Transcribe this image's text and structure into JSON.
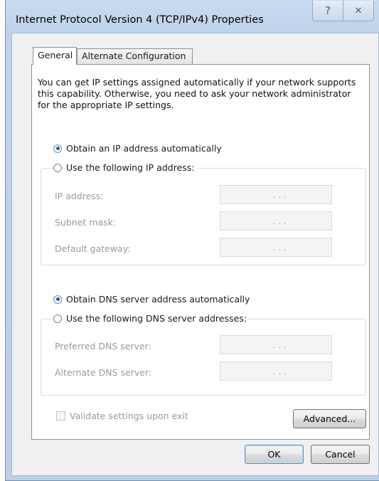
{
  "window": {
    "title": "Internet Protocol Version 4 (TCP/IPv4) Properties",
    "help_glyph": "?",
    "close_glyph": "✕"
  },
  "tabs": [
    {
      "label": "General",
      "selected": true
    },
    {
      "label": "Alternate Configuration",
      "selected": false
    }
  ],
  "general": {
    "intro": "You can get IP settings assigned automatically if your network supports this capability. Otherwise, you need to ask your network administrator for the appropriate IP settings.",
    "ip_auto_label": "Obtain an IP address automatically",
    "ip_manual_label": "Use the following IP address:",
    "ip_fields": [
      {
        "label": "IP address:",
        "value": ". . ."
      },
      {
        "label": "Subnet mask:",
        "value": ". . ."
      },
      {
        "label": "Default gateway:",
        "value": ". . ."
      }
    ],
    "dns_auto_label": "Obtain DNS server address automatically",
    "dns_manual_label": "Use the following DNS server addresses:",
    "dns_fields": [
      {
        "label": "Preferred DNS server:",
        "value": ". . ."
      },
      {
        "label": "Alternate DNS server:",
        "value": ". . ."
      }
    ],
    "validate_label": "Validate settings upon exit",
    "advanced_label": "Advanced..."
  },
  "buttons": {
    "ok": "OK",
    "cancel": "Cancel"
  },
  "colors": {
    "frame": "#bed2ea",
    "accent": "#1d5ea8"
  }
}
